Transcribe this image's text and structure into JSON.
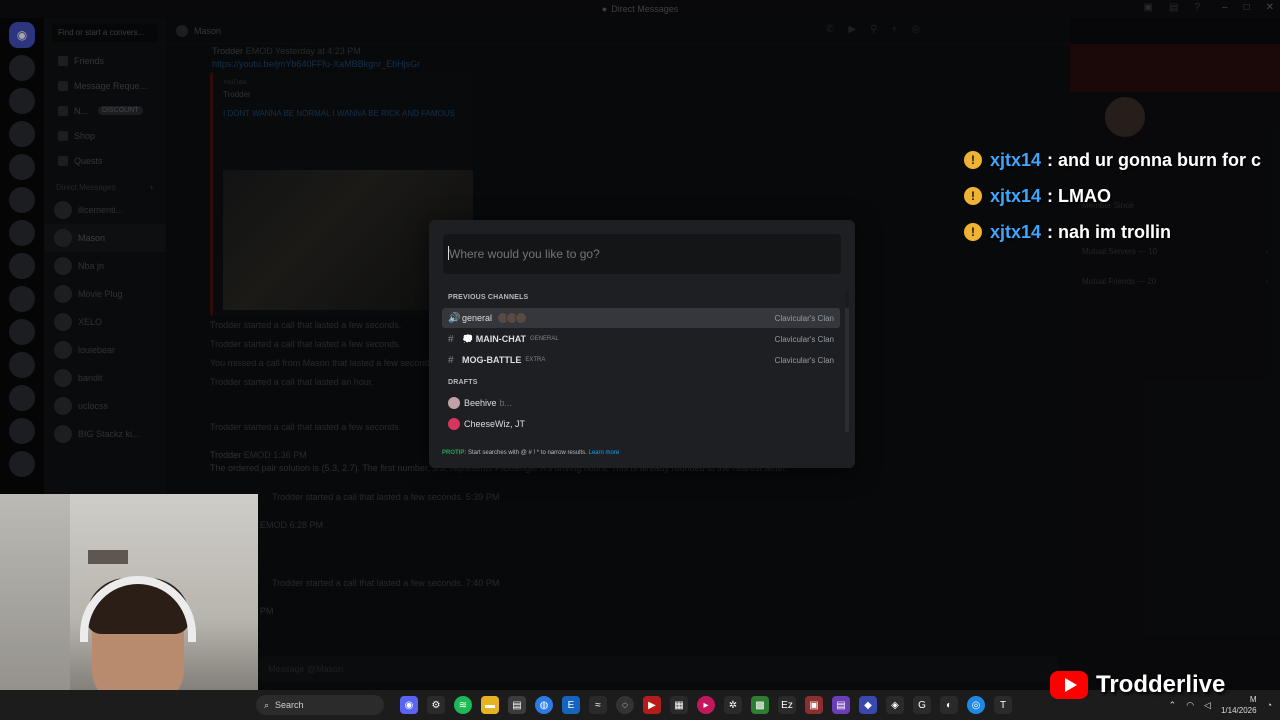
{
  "titlebar": {
    "title": "Direct Messages"
  },
  "sidebar": {
    "search_placeholder": "Find or start a convers...",
    "nav": [
      {
        "label": "Friends"
      },
      {
        "label": "Message Reque..."
      },
      {
        "label": "N...",
        "badge": "DISCOUNT"
      },
      {
        "label": "Shop"
      },
      {
        "label": "Quests"
      }
    ],
    "dm_header": "Direct Messages",
    "dms": [
      {
        "label": "illcementi..."
      },
      {
        "label": "Mason"
      },
      {
        "label": "Nba jn"
      },
      {
        "label": "Movie Plug"
      },
      {
        "label": "XELO"
      },
      {
        "label": "louiebear"
      },
      {
        "label": "bandit"
      },
      {
        "label": "uclocss"
      },
      {
        "label": "BIG Stackz ki..."
      }
    ]
  },
  "chat": {
    "header_name": "Mason",
    "first_author": "Trodder",
    "first_badge": "EMOD",
    "first_time": "Yesterday at 4:23 PM",
    "first_link": "https://youtu.be/jmYb640FFfu-XaMBBkgnr_EbHjsGr",
    "embed": {
      "provider": "YouTube",
      "channel": "Trodder",
      "title": "I DONT WANNA BE NORMAL I WANNA BE RICK AND FAMOUS"
    },
    "calls": [
      "Trodder started a call that lasted a few seconds.",
      "Trodder started a call that lasted a few seconds.",
      "You missed a call from Mason that lasted a few seconds.",
      "Trodder started a call that lasted an hour."
    ],
    "call2": "Trodder started a call that lasted a few seconds.",
    "second_author": "Trodder",
    "second_badge": "EMOD",
    "second_time": "1:36 PM",
    "second_text": "The ordered pair solution is (5.3, 2.7). The first number, 5.3, represents Passenger A's driving hours. This is already rounded to the nearest tenth.",
    "call3": "Trodder started a call that lasted a few seconds.",
    "call3_time": "5:39 PM",
    "emod_label": "EMOD",
    "emod_time": "6:28 PM",
    "call4": "Trodder started a call that lasted a few seconds.",
    "call4_time": "7:40 PM",
    "pm_label": "PM",
    "composer_placeholder": "Message @Mason"
  },
  "profile": {
    "member_since": "Member Since",
    "mutual_servers": "Mutual Servers — 10",
    "mutual_friends": "Mutual Friends — 20"
  },
  "switcher": {
    "placeholder": "Where would you like to go?",
    "section_previous": "PREVIOUS CHANNELS",
    "channels": [
      {
        "symbol": "🔊",
        "name": "general",
        "tag": "",
        "server": "Clavicular's Clan"
      },
      {
        "symbol": "#",
        "name": "💭 MAIN-CHAT",
        "tag": "GENERAL",
        "server": "Clavicular's Clan"
      },
      {
        "symbol": "#",
        "name": "MOG-BATTLE",
        "tag": "EXTRA",
        "server": "Clavicular's Clan"
      }
    ],
    "section_drafts": "DRAFTS",
    "drafts": [
      {
        "name": "Beehive",
        "extra": "b..."
      },
      {
        "name": "CheeseWiz, JT",
        "extra": ""
      }
    ],
    "protip_label": "PROTIP:",
    "protip_text": "Start searches with @ # ! * to narrow results.",
    "protip_link": "Learn more"
  },
  "overlay_chat": [
    {
      "user": "xjtx14",
      "message": ": and ur gonna burn for c"
    },
    {
      "user": "xjtx14",
      "message": ": LMAO"
    },
    {
      "user": "xjtx14",
      "message": ": nah im trollin"
    }
  ],
  "brand": {
    "name": "Trodderlive"
  },
  "taskbar": {
    "search_label": "Search",
    "time": "M",
    "date": "1/14/2026"
  }
}
